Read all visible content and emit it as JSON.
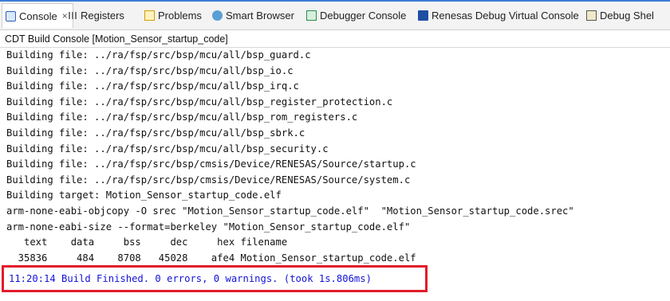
{
  "tabs": [
    {
      "label": "Console",
      "icon": "console-icon",
      "active": true
    },
    {
      "label": "Registers",
      "icon": "registers-icon"
    },
    {
      "label": "Problems",
      "icon": "problems-icon"
    },
    {
      "label": "Smart Browser",
      "icon": "smart-browser-icon"
    },
    {
      "label": "Debugger Console",
      "icon": "debugger-console-icon"
    },
    {
      "label": "Renesas Debug Virtual Console",
      "icon": "virtual-console-icon"
    },
    {
      "label": "Debug Shel",
      "icon": "debug-shell-icon"
    }
  ],
  "close_glyph": "×",
  "console_title": "CDT Build Console [Motion_Sensor_startup_code]",
  "lines": [
    "Building file: ../ra/fsp/src/bsp/mcu/all/bsp_guard.c",
    "Building file: ../ra/fsp/src/bsp/mcu/all/bsp_io.c",
    "Building file: ../ra/fsp/src/bsp/mcu/all/bsp_irq.c",
    "Building file: ../ra/fsp/src/bsp/mcu/all/bsp_register_protection.c",
    "Building file: ../ra/fsp/src/bsp/mcu/all/bsp_rom_registers.c",
    "Building file: ../ra/fsp/src/bsp/mcu/all/bsp_sbrk.c",
    "Building file: ../ra/fsp/src/bsp/mcu/all/bsp_security.c",
    "Building file: ../ra/fsp/src/bsp/cmsis/Device/RENESAS/Source/startup.c",
    "Building file: ../ra/fsp/src/bsp/cmsis/Device/RENESAS/Source/system.c",
    "Building target: Motion_Sensor_startup_code.elf",
    "arm-none-eabi-objcopy -O srec \"Motion_Sensor_startup_code.elf\"  \"Motion_Sensor_startup_code.srec\"",
    "arm-none-eabi-size --format=berkeley \"Motion_Sensor_startup_code.elf\"",
    "   text    data     bss     dec     hex filename",
    "  35836     484    8708   45028    afe4 Motion_Sensor_startup_code.elf"
  ],
  "finish_line": "11:20:14 Build Finished. 0 errors, 0 warnings. (took 1s.806ms)"
}
